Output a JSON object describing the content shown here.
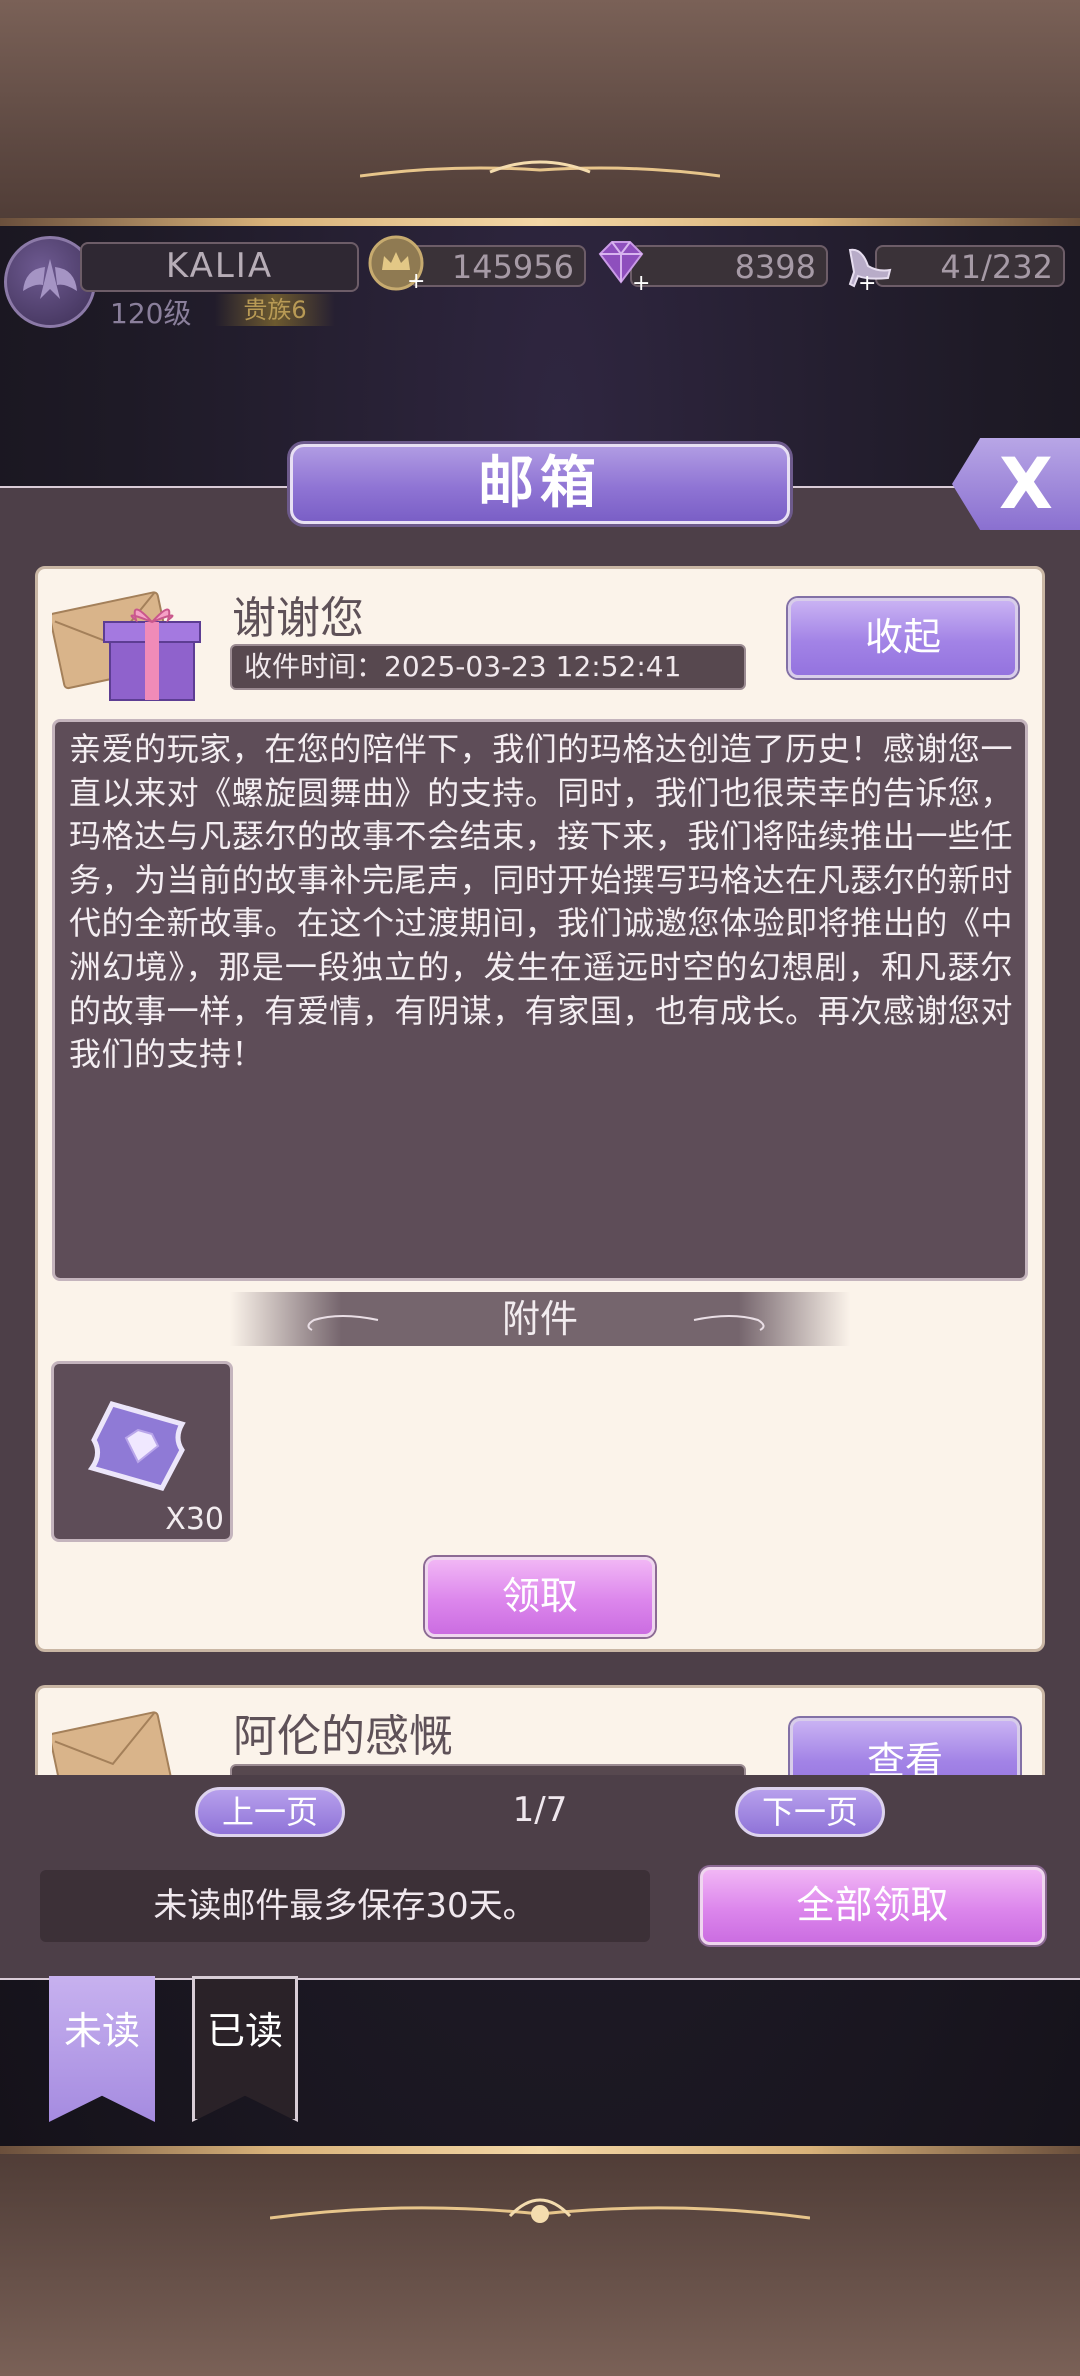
{
  "status": {
    "player_name": "KALIA",
    "level": "120级",
    "rank": "贵族6",
    "gold": "145956",
    "diamonds": "8398",
    "stamina": "41/232"
  },
  "mailbox": {
    "title": "邮箱",
    "close_label": "X",
    "mails": [
      {
        "subject": "谢谢您",
        "time_label": "收件时间：",
        "time": "2025-03-23 12:52:41",
        "action_label": "收起",
        "body": "亲爱的玩家，在您的陪伴下，我们的玛格达创造了历史！感谢您一直以来对《螺旋圆舞曲》的支持。同时，我们也很荣幸的告诉您，玛格达与凡瑟尔的故事不会结束，接下来，我们将陆续推出一些任务，为当前的故事补完尾声，同时开始撰写玛格达在凡瑟尔的新时代的全新故事。在这个过渡期间，我们诚邀您体验即将推出的《中洲幻境》，那是一段独立的，发生在遥远时空的幻想剧，和凡瑟尔的故事一样，有爱情，有阴谋，有家国，也有成长。再次感谢您对我们的支持！",
        "attachment_header": "附件",
        "attachments": [
          {
            "icon": "diamond-ticket-icon",
            "quantity": "X30"
          }
        ],
        "claim_label": "领取"
      },
      {
        "subject": "阿伦的感慨",
        "action_label": "查看"
      }
    ],
    "pagination": {
      "prev_label": "上一页",
      "page": "1/7",
      "next_label": "下一页"
    },
    "notice": "未读邮件最多保存30天。",
    "claim_all_label": "全部领取",
    "tabs": [
      {
        "label": "未读",
        "active": true
      },
      {
        "label": "已读",
        "active": false
      }
    ]
  },
  "colors": {
    "accent_purple": "#9473df",
    "accent_pink": "#cb6de1",
    "card_bg": "#fbf3ea",
    "panel_bg": "#4d3f48"
  }
}
